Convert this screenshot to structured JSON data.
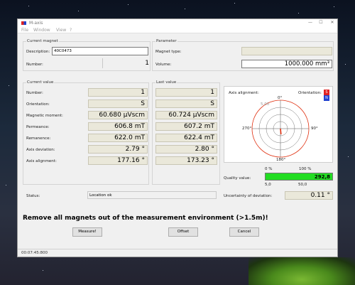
{
  "window": {
    "title": "M-axis"
  },
  "menu": [
    "File",
    "Window",
    "View",
    "?"
  ],
  "current_magnet": {
    "title": "Current magnet",
    "description_label": "Description:",
    "description_value": "40C0473",
    "number_label": "Number:",
    "number_value": "1"
  },
  "parameter": {
    "title": "Parameter",
    "type_label": "Magnet type:",
    "type_value": "",
    "volume_label": "Volume:",
    "volume_value": "1000.000 mm³"
  },
  "current_value": {
    "title": "Current value",
    "rows": [
      {
        "label": "Number:",
        "value": "1"
      },
      {
        "label": "Orientation:",
        "value": "S"
      },
      {
        "label": "Magnetic moment:",
        "value": "60.680 µVscm"
      },
      {
        "label": "Permeance:",
        "value": "606.8 mT"
      },
      {
        "label": "Remanence:",
        "value": "622.0 mT"
      },
      {
        "label": "Axis deviation:",
        "value": "2.79 °"
      },
      {
        "label": "Axis alignment:",
        "value": "177.16 °"
      }
    ]
  },
  "last_value": {
    "title": "Last value",
    "values": [
      "1",
      "S",
      "60.724 µVscm",
      "607.2 mT",
      "622.4 mT",
      "2.80 °",
      "173.23 °"
    ]
  },
  "alignment": {
    "title": "Axis alignment:",
    "orientation_label": "Orientation:",
    "orientation_badges": [
      "S",
      "N"
    ],
    "axis_labels": {
      "top": "0°",
      "right": "90°",
      "bottom": "180°",
      "left": "270°"
    },
    "ring_label": "5,00",
    "accent": "#e03010"
  },
  "quality": {
    "label": "Quality value:",
    "scale_top": [
      "0 %",
      "100 %"
    ],
    "scale_bottom": [
      "5,0",
      "50,0"
    ],
    "value": "292,8",
    "fill_fraction": 1.0,
    "color": "#22dd22"
  },
  "uncertainty": {
    "label": "Uncertainty of deviation:",
    "value": "0.11 °"
  },
  "status": {
    "label": "Status:",
    "value": "Location ok"
  },
  "warning": "Remove all magnets out of the measurement environment (>1.5m)!",
  "buttons": {
    "measure": "Measure!",
    "offset": "Offset",
    "cancel": "Cancel"
  },
  "statusbar": {
    "time": "00:07:45:800"
  }
}
